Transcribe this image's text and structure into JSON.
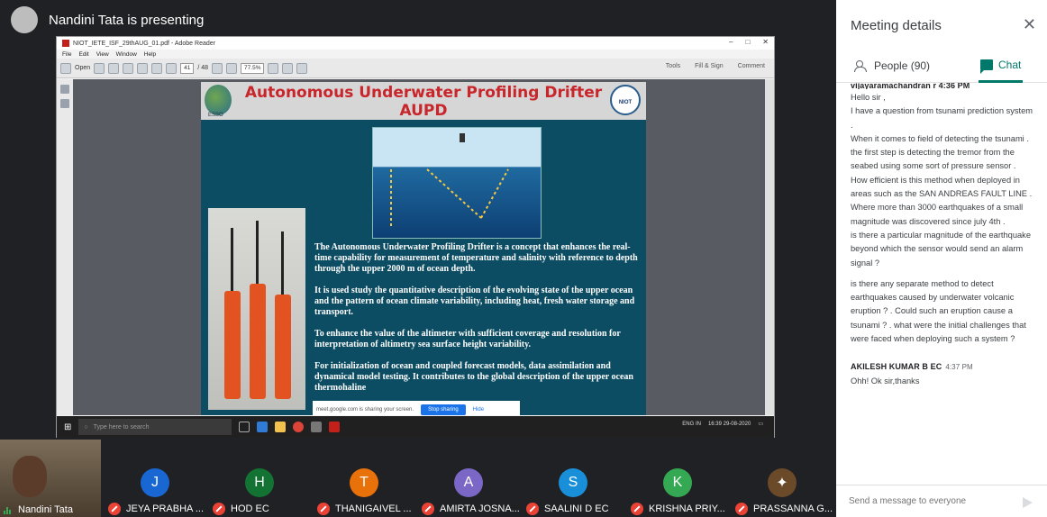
{
  "presenter": {
    "label": "Nandini Tata is presenting"
  },
  "shared_window": {
    "title": "NIOT_IETE_ISF_29thAUG_01.pdf - Adobe Reader",
    "menu": [
      "File",
      "Edit",
      "View",
      "Window",
      "Help"
    ],
    "toolbar": {
      "open": "Open",
      "page_current": "41",
      "page_total": "/ 48",
      "zoom": "77.5%",
      "tools": "Tools",
      "fill_sign": "Fill & Sign",
      "comment": "Comment"
    }
  },
  "slide": {
    "title_line1": "Autonomous Underwater Profiling Drifter",
    "title_line2": "AUPD",
    "logo_left_text": "ESSO",
    "logo_right_text": "NIOT",
    "paragraphs": [
      "The Autonomous Underwater Profiling Drifter is a concept that enhances the real-time capability for measurement of temperature and salinity with reference to depth through the upper 2000 m of ocean depth.",
      "It is used study the quantitative description of the evolving state of the upper ocean and the pattern of ocean climate variability, including heat, fresh water storage and transport.",
      "To enhance the value of the altimeter with sufficient coverage and resolution for interpretation of altimetry sea surface height variability.",
      "For initialization of ocean and coupled forecast models, data assimilation and dynamical model testing. It contributes to the global description of the upper ocean thermohaline"
    ]
  },
  "share_notice": {
    "text": "meet.google.com is sharing your screen.",
    "stop": "Stop sharing",
    "hide": "Hide"
  },
  "taskbar": {
    "search_placeholder": "Type here to search",
    "lang": "ENG",
    "region": "IN",
    "time": "16:39",
    "date": "29-08-2020"
  },
  "participants": [
    {
      "initial": "",
      "name": "Nandini Tata",
      "color": "",
      "muted": false
    },
    {
      "initial": "J",
      "name": "JEYA PRABHA ...",
      "color": "#1967d2",
      "muted": true
    },
    {
      "initial": "H",
      "name": "HOD EC",
      "color": "#137333",
      "muted": true
    },
    {
      "initial": "T",
      "name": "THANIGAIVEL ...",
      "color": "#e8710a",
      "muted": true
    },
    {
      "initial": "A",
      "name": "AMIRTA JOSNA...",
      "color": "#7b68c6",
      "muted": true
    },
    {
      "initial": "S",
      "name": "SAALINI D EC",
      "color": "#1a8fd9",
      "muted": true
    },
    {
      "initial": "K",
      "name": "KRISHNA PRIY...",
      "color": "#34a853",
      "muted": true
    },
    {
      "initial": "",
      "name": "PRASSANNA G...",
      "color": "#3c3c3c",
      "muted": true
    }
  ],
  "panel": {
    "title": "Meeting details",
    "tab_people": "People (90)",
    "tab_chat": "Chat",
    "cut_sender": "vijayaramachandran r 4:36 PM",
    "message_lines": [
      "Hello sir ,",
      "I have a question from tsunami prediction system .",
      "When it comes to field of detecting the tsunami .",
      "the first step is detecting the tremor from the seabed using some sort of pressure sensor .",
      "How efficient is this method  when deployed in areas such as the SAN ANDREAS FAULT LINE .",
      "Where more than 3000 earthquakes of a small magnitude was discovered since july 4th .",
      "is there a particular magnitude of the earthquake beyond which the sensor would send an alarm signal ?"
    ],
    "message2": "is there any separate method to detect earthquakes caused by underwater volcanic eruption ? . Could such an eruption cause a tsunami ? . what were the initial challenges that were faced when deploying such a system ?",
    "sender2": "AKILESH KUMAR B EC",
    "time2": "4:37 PM",
    "message3": "Ohh! Ok sir,thanks",
    "composer_placeholder": "Send a message to everyone"
  }
}
